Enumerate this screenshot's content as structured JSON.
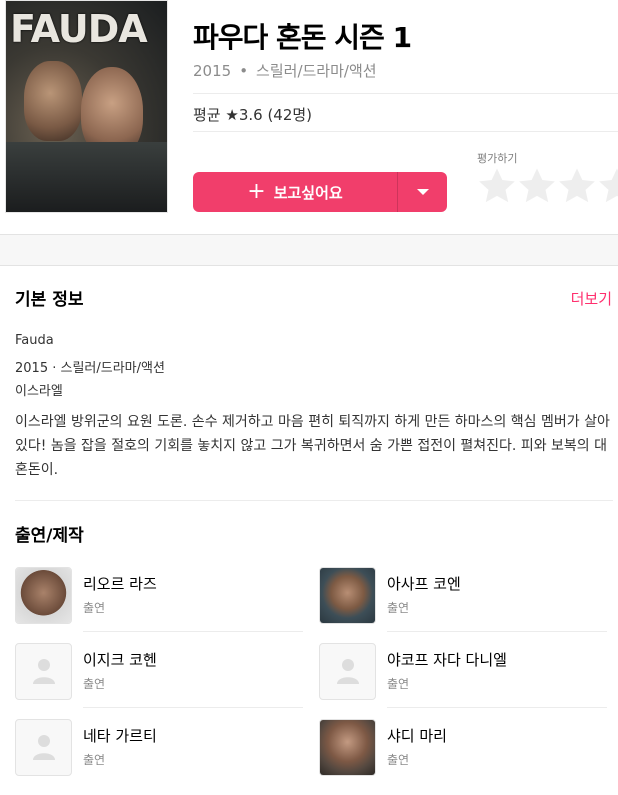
{
  "poster": {
    "title_text": "FAUDA"
  },
  "header": {
    "title": "파우다 혼돈 시즌 1",
    "year": "2015",
    "separator": "•",
    "genres": "스릴러/드라마/액션",
    "average": "평균 ★3.6 (42명)",
    "want_label": "보고싶어요",
    "want_plus": "+",
    "rate_label": "평가하기",
    "stars_total": 5
  },
  "colors": {
    "accent": "#f13e6b",
    "more": "#ff2f6e",
    "star_empty": "#eeeeee"
  },
  "basic_info": {
    "heading": "기본 정보",
    "more": "더보기",
    "original_title": "Fauda",
    "year_genre": "2015 · 스릴러/드라마/액션",
    "country": "이스라엘",
    "description": "이스라엘 방위군의 요원 도론. 손수 제거하고 마음 편히 퇴직까지 하게 만든 하마스의 핵심 멤버가 살아있다! 놈을 잡을 절호의 기회를 놓치지 않고 그가 복귀하면서 숨 가쁜 접전이 펼쳐진다. 피와 보복의 대혼돈이."
  },
  "cast": {
    "heading": "출연/제작",
    "people": [
      {
        "name": "리오르 라즈",
        "role": "출연",
        "photo": "photo"
      },
      {
        "name": "아사프 코엔",
        "role": "출연",
        "photo": "photo"
      },
      {
        "name": "이지크 코헨",
        "role": "출연",
        "photo": "placeholder-person-icon"
      },
      {
        "name": "야코프 자다 다니엘",
        "role": "출연",
        "photo": "placeholder-person-icon"
      },
      {
        "name": "네타 가르티",
        "role": "출연",
        "photo": "placeholder-person-icon"
      },
      {
        "name": "샤디 마리",
        "role": "출연",
        "photo": "photo"
      }
    ]
  }
}
